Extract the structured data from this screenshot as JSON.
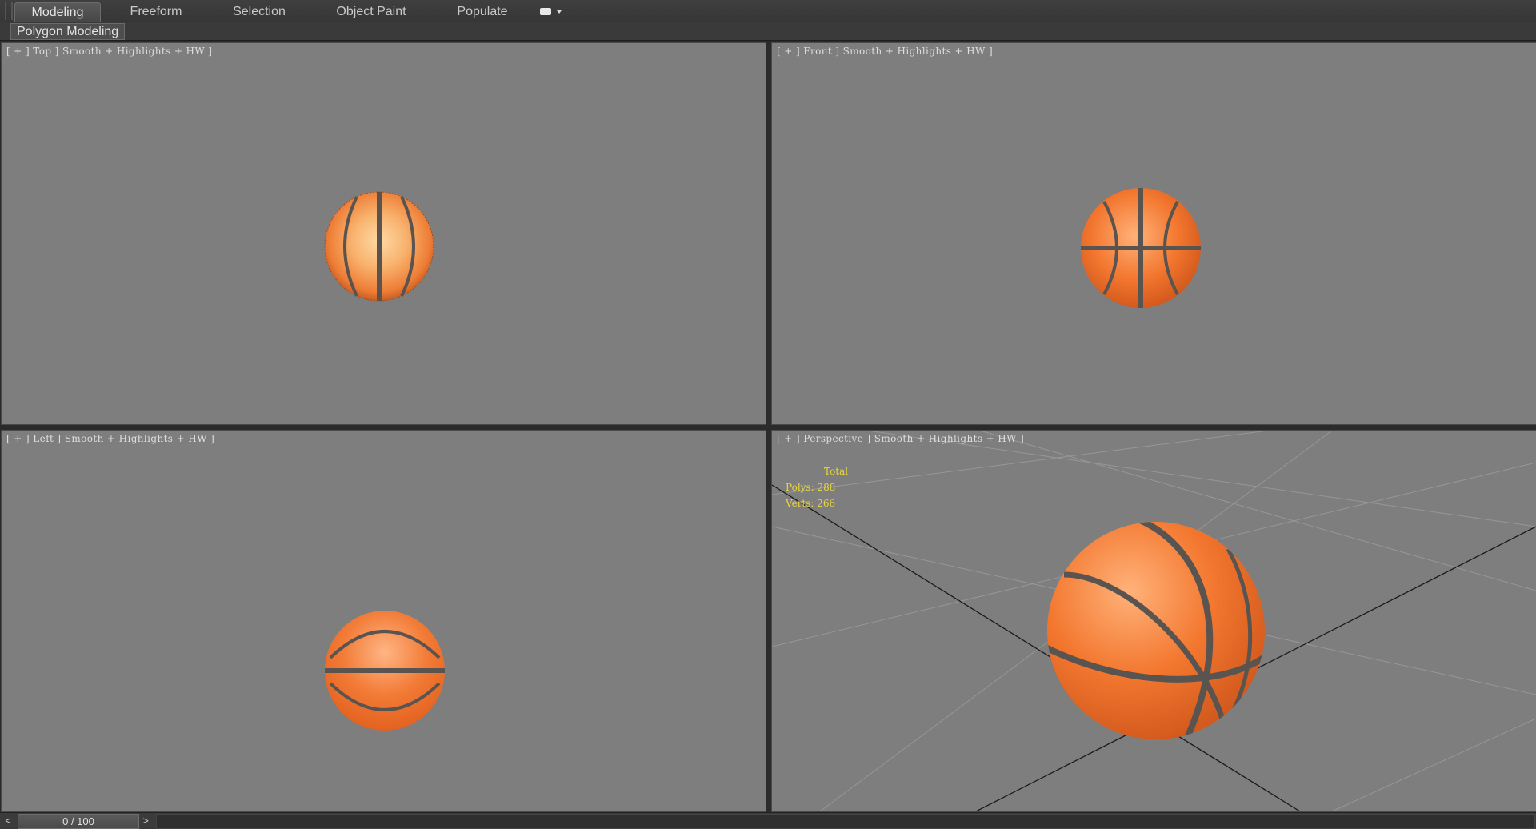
{
  "ribbon": {
    "tabs": [
      {
        "label": "Modeling",
        "active": true
      },
      {
        "label": "Freeform",
        "active": false
      },
      {
        "label": "Selection",
        "active": false
      },
      {
        "label": "Object Paint",
        "active": false
      },
      {
        "label": "Populate",
        "active": false
      }
    ],
    "options_icon": "ribbon-options-icon"
  },
  "panel": {
    "label": "Polygon Modeling"
  },
  "viewports": {
    "top": {
      "label": "[ + ] Top ] Smooth + Highlights + HW ]"
    },
    "front": {
      "label": "[ + ] Front ] Smooth + Highlights + HW ]"
    },
    "left": {
      "label": "[ + ] Left ] Smooth + Highlights + HW ]"
    },
    "perspective": {
      "label": "[ + ] Perspective ] Smooth + Highlights + HW ]",
      "stats": {
        "title": "Total",
        "polys": "Polys: 288",
        "verts": "Verts: 266"
      }
    }
  },
  "timeslider": {
    "prev": "<",
    "value": "0 / 100",
    "next": ">"
  },
  "colors": {
    "viewport_bg": "#7e7e7e",
    "ball_orange": "#f07a34",
    "ball_seam": "#5a5450",
    "stats_text": "#e9d63a"
  }
}
